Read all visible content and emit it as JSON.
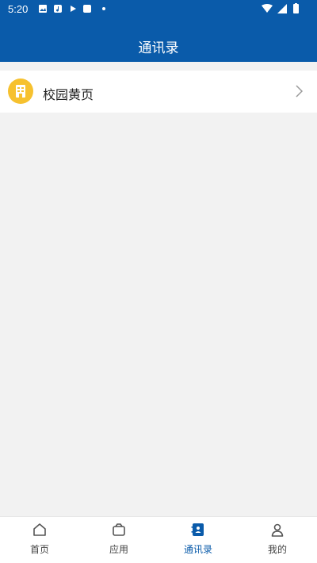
{
  "status_bar": {
    "time": "5:20"
  },
  "header": {
    "title": "通讯录"
  },
  "list": {
    "items": [
      {
        "label": "校园黄页",
        "icon": "building-icon",
        "chevron": "chevron-right-icon"
      }
    ]
  },
  "tabs": [
    {
      "label": "首页",
      "icon": "home-icon",
      "active": false
    },
    {
      "label": "应用",
      "icon": "wallet-icon",
      "active": false
    },
    {
      "label": "通讯录",
      "icon": "contacts-icon",
      "active": true
    },
    {
      "label": "我的",
      "icon": "user-icon",
      "active": false
    }
  ],
  "colors": {
    "primary": "#0a5baa",
    "accent": "#f6c12f",
    "background": "#f2f2f2"
  }
}
